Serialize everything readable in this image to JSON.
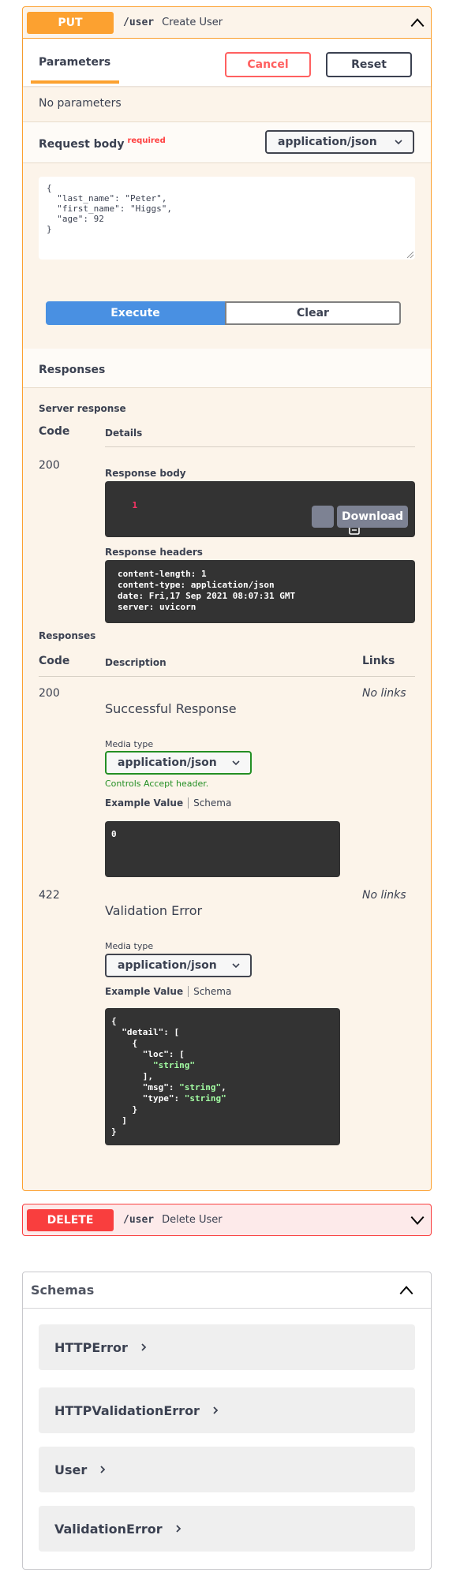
{
  "put_op": {
    "method": "PUT",
    "path": "/user",
    "summary": "Create User",
    "params_tab": "Parameters",
    "cancel_label": "Cancel",
    "reset_label": "Reset",
    "no_params": "No parameters",
    "request_body_title": "Request body",
    "required_label": "required",
    "content_type": "application/json",
    "request_body_lines": [
      "{",
      "  \"last_name\": \"Peter\",",
      "  \"first_name\": \"Higgs\",",
      "  \"age\": 92",
      "}"
    ],
    "execute_label": "Execute",
    "clear_label": "Clear",
    "responses_title": "Responses",
    "server_response_label": "Server response",
    "code_col": "Code",
    "details_col": "Details",
    "server_code": "200",
    "response_body_label": "Response body",
    "response_body_value": "1",
    "download_label": "Download",
    "response_headers_label": "Response headers",
    "response_headers_lines": [
      "content-length: 1",
      "content-type: application/json",
      "date: Fri,17 Sep 2021 08:07:31 GMT",
      "server: uvicorn"
    ],
    "responses_label": "Responses",
    "description_col": "Description",
    "links_col": "Links",
    "responses": [
      {
        "code": "200",
        "no_links": "No links",
        "description": "Successful Response",
        "media_type_label": "Media type",
        "media_type": "application/json",
        "controls_note": "Controls Accept header.",
        "example_tab": "Example Value",
        "schema_tab": "Schema",
        "example_lines": [
          "0"
        ]
      },
      {
        "code": "422",
        "no_links": "No links",
        "description": "Validation Error",
        "media_type_label": "Media type",
        "media_type": "application/json",
        "example_tab": "Example Value",
        "schema_tab": "Schema",
        "example_lines": [
          "{",
          "  \"detail\": [",
          "    {",
          "      \"loc\": [",
          "        \"string\"",
          "      ],",
          "      \"msg\": \"string\",",
          "      \"type\": \"string\"",
          "    }",
          "  ]",
          "}"
        ]
      }
    ]
  },
  "delete_op": {
    "method": "DELETE",
    "path": "/user",
    "summary": "Delete User"
  },
  "schemas": {
    "title": "Schemas",
    "items": [
      "HTTPError",
      "HTTPValidationError",
      "User",
      "ValidationError"
    ]
  },
  "colors": {
    "put": "#fca130",
    "delete": "#f93e3e",
    "execute": "#4990e2",
    "cancel": "#ff6060",
    "string_value": "#a2fca2"
  },
  "icons": {
    "collapse": "chevron-up-icon",
    "expand": "chevron-down-icon",
    "copy": "clipboard-icon",
    "schema_expand": "chevron-right-icon"
  }
}
